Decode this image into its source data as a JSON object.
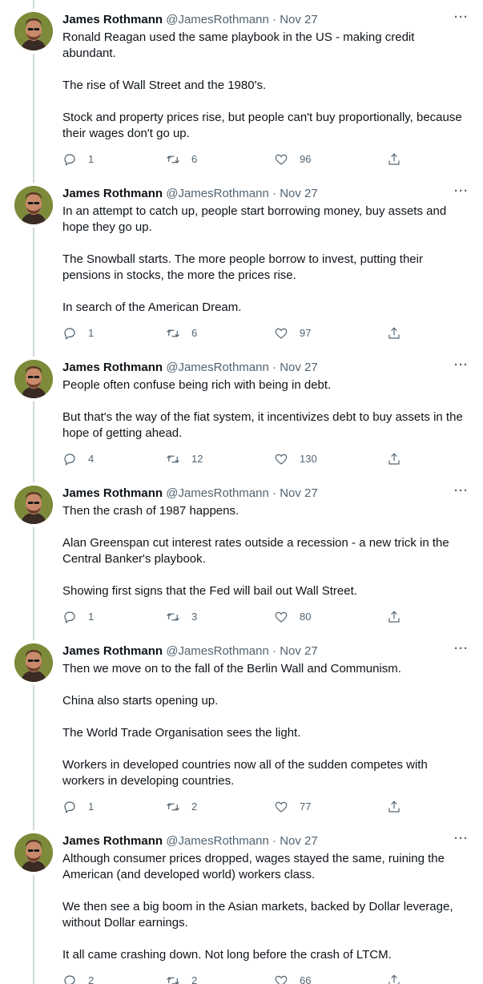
{
  "author": {
    "name": "James Rothmann",
    "handle": "@JamesRothmann",
    "separator": "·"
  },
  "colors": {
    "text": "#0f1419",
    "muted": "#536471",
    "thread_line": "#cfd9de",
    "avatar_bg": "#7d8a3a"
  },
  "icons": {
    "reply": "reply-icon",
    "retweet": "retweet-icon",
    "like": "heart-icon",
    "share": "share-icon",
    "more": "more-options-icon"
  },
  "tweets": [
    {
      "date": "Nov 27",
      "paragraphs": [
        "Ronald Reagan used the same playbook in the US - making credit abundant.",
        "The rise of Wall Street and the 1980's.",
        "Stock and property prices rise, but people can't buy proportionally, because their wages don't go up."
      ],
      "replies": "1",
      "retweets": "6",
      "likes": "96"
    },
    {
      "date": "Nov 27",
      "paragraphs": [
        "In an attempt to catch up, people start borrowing money, buy assets and hope they go up.",
        "The Snowball starts. The more people borrow to invest, putting their pensions in stocks, the more the prices rise.",
        "In search of the American Dream."
      ],
      "replies": "1",
      "retweets": "6",
      "likes": "97"
    },
    {
      "date": "Nov 27",
      "paragraphs": [
        "People often confuse being rich with being in debt.",
        "But that's the way of the fiat system, it incentivizes debt to buy assets in the hope of getting ahead."
      ],
      "replies": "4",
      "retweets": "12",
      "likes": "130"
    },
    {
      "date": "Nov 27",
      "paragraphs": [
        "Then the crash of 1987 happens.",
        "Alan Greenspan cut interest rates outside a recession - a new trick in the Central Banker's playbook.",
        "Showing first signs that the Fed will bail out Wall Street."
      ],
      "replies": "1",
      "retweets": "3",
      "likes": "80"
    },
    {
      "date": "Nov 27",
      "paragraphs": [
        "Then we move on to the fall of the Berlin Wall and Communism.",
        "China also starts opening up.",
        "The World Trade Organisation sees the light.",
        "Workers in developed countries now all of the sudden competes with workers in developing countries."
      ],
      "replies": "1",
      "retweets": "2",
      "likes": "77"
    },
    {
      "date": "Nov 27",
      "paragraphs": [
        "Although consumer prices dropped, wages stayed the same, ruining the American (and developed world) workers class.",
        "We then see a big boom in the Asian markets, backed by Dollar leverage, without Dollar earnings.",
        "It all came crashing down. Not long before the crash of LTCM."
      ],
      "replies": "2",
      "retweets": "2",
      "likes": "66"
    }
  ]
}
